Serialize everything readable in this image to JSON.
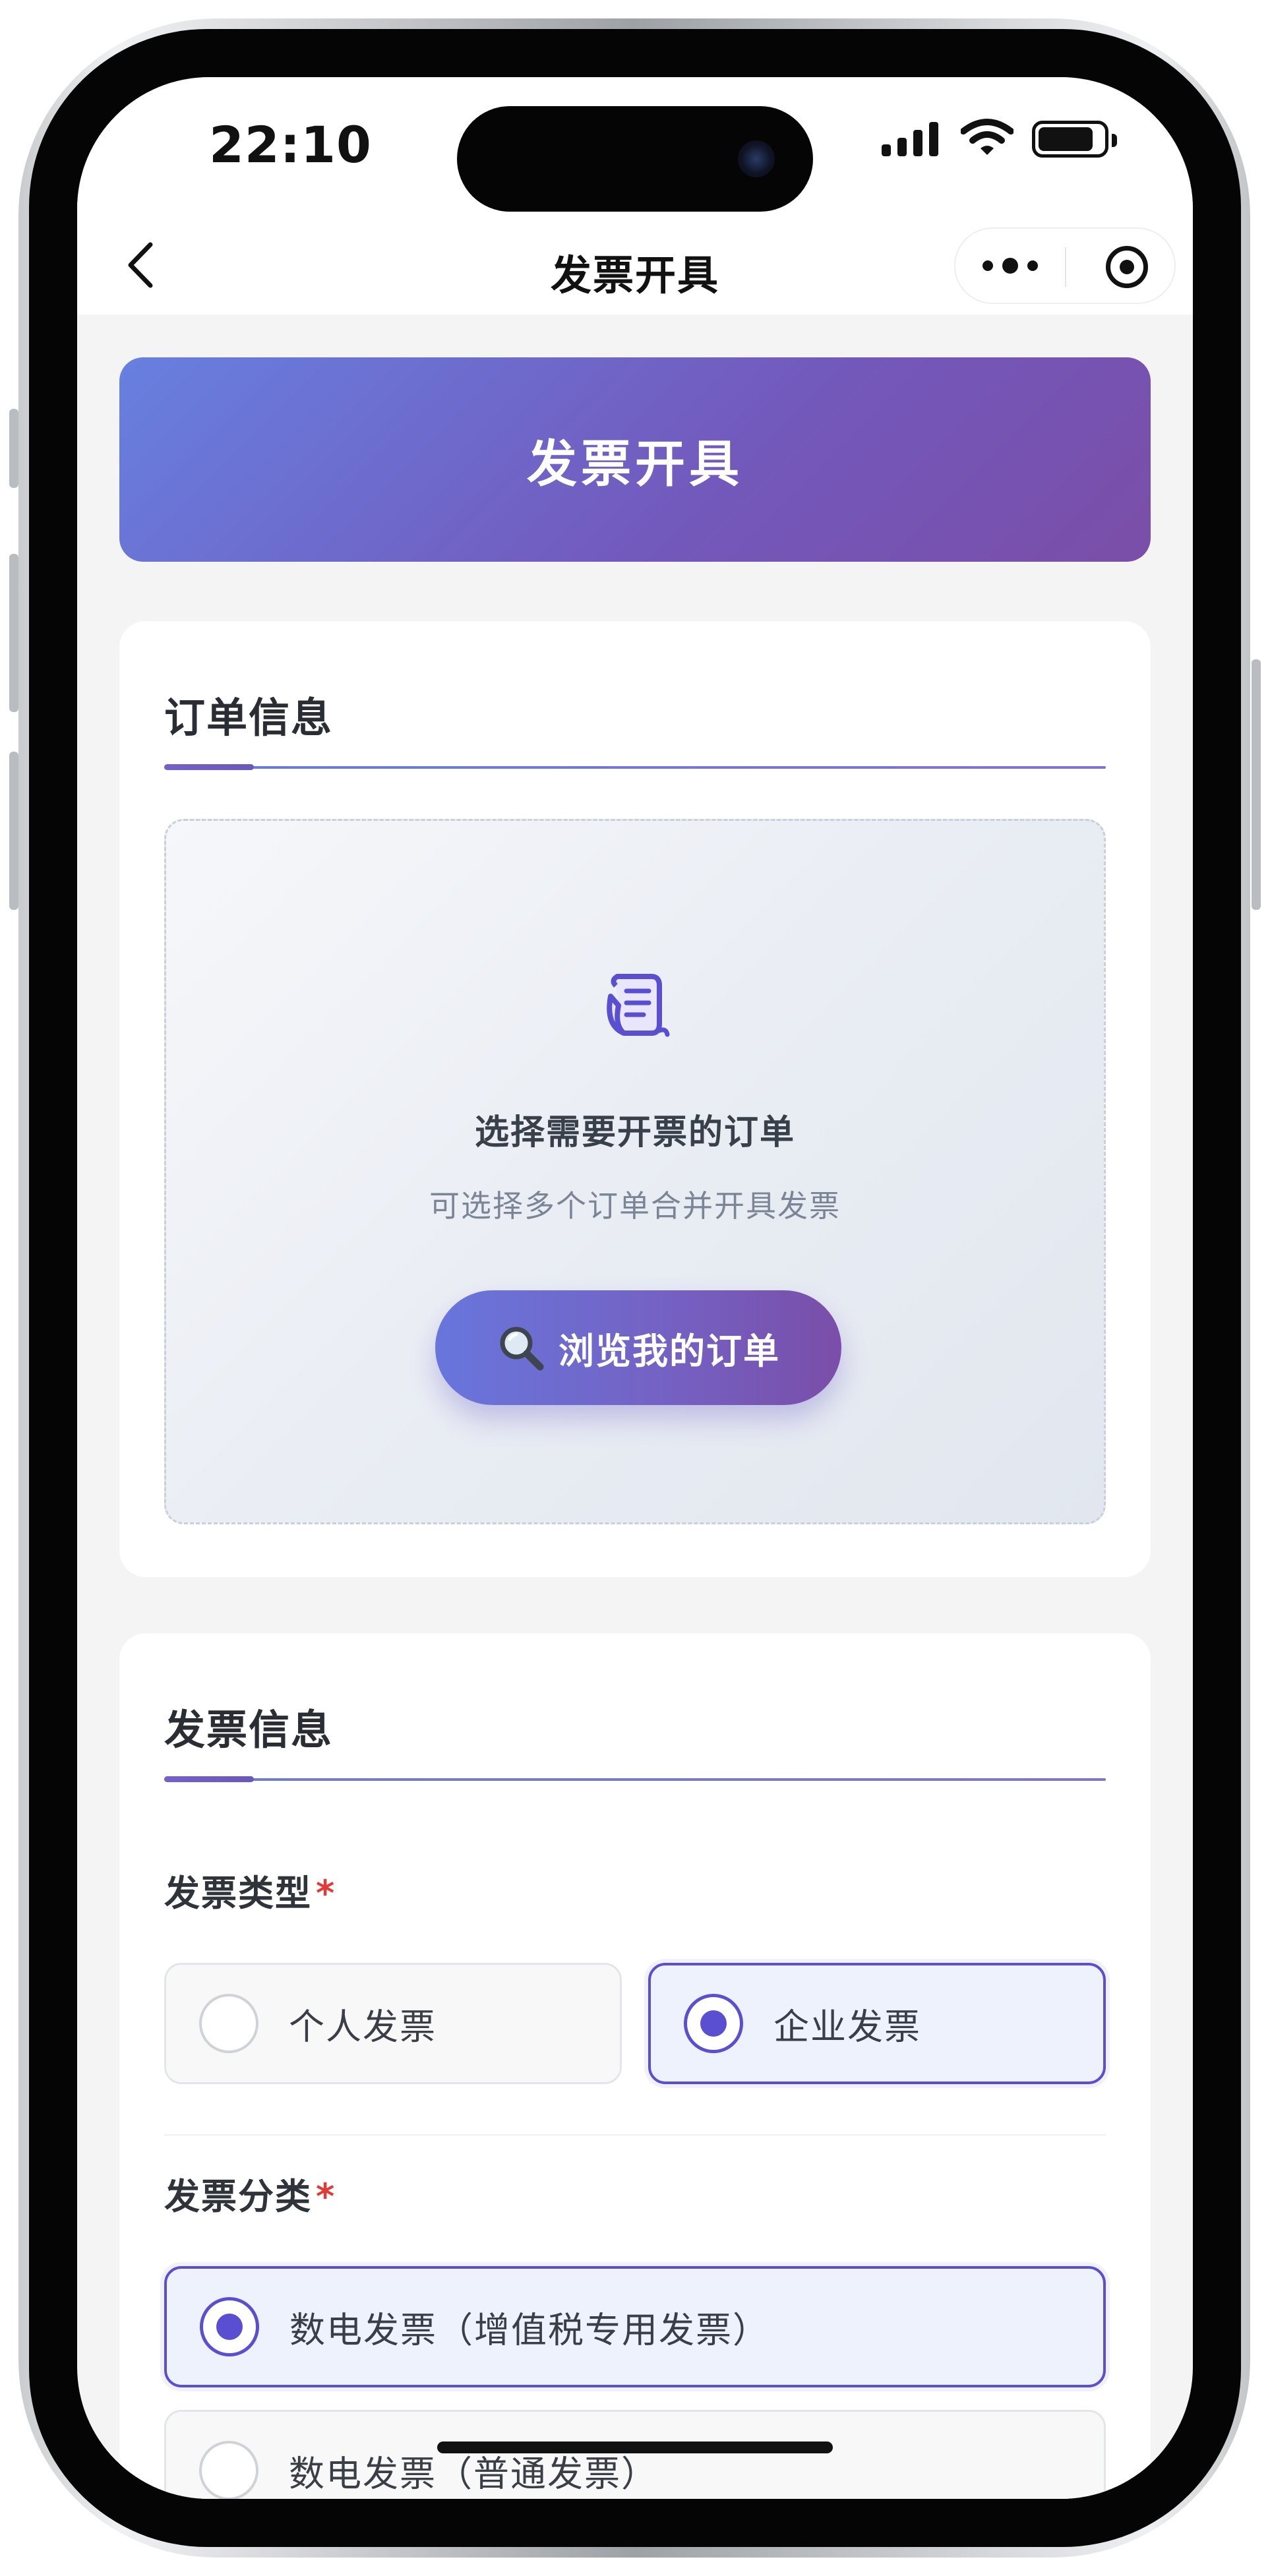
{
  "status_bar": {
    "time": "22:10",
    "battery_level": 0.85
  },
  "nav": {
    "title": "发票开具",
    "back_icon": "chevron-left-icon",
    "more_icon": "more-dots-icon",
    "close_icon": "target-circle-icon"
  },
  "banner": {
    "title": "发票开具"
  },
  "order_section": {
    "title": "订单信息",
    "icon": "scroll-icon",
    "prompt_title": "选择需要开票的订单",
    "prompt_subtitle": "可选择多个订单合并开具发票",
    "browse_button": {
      "icon": "magnifier-icon",
      "label": "浏览我的订单"
    }
  },
  "invoice_section": {
    "title": "发票信息",
    "invoice_type": {
      "label": "发票类型",
      "required_mark": "*",
      "options": [
        {
          "label": "个人发票",
          "selected": false
        },
        {
          "label": "企业发票",
          "selected": true
        }
      ]
    },
    "invoice_category": {
      "label": "发票分类",
      "required_mark": "*",
      "options": [
        {
          "label": "数电发票（增值税专用发票）",
          "selected": true
        },
        {
          "label": "数电发票（普通发票）",
          "selected": false
        }
      ]
    }
  },
  "colors": {
    "brand_gradient_start": "#6780e0",
    "brand_gradient_end": "#7a4ea8",
    "accent": "#5b4fd1",
    "required": "#e53935",
    "page_background": "#f4f4f5"
  }
}
